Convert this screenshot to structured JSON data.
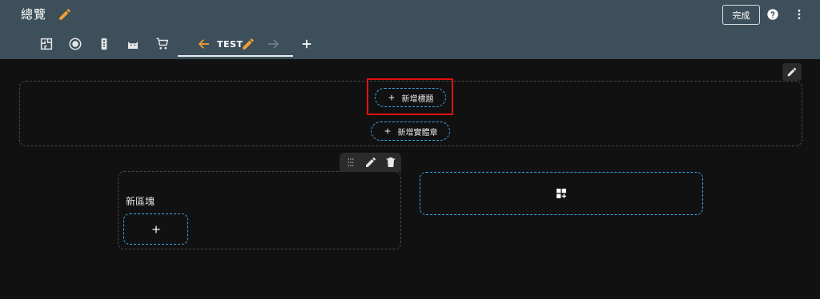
{
  "header": {
    "title": "總覽",
    "done_label": "完成",
    "icons": [
      "pencil-icon",
      "help-icon",
      "more-vert-icon"
    ]
  },
  "tabs": {
    "icons": [
      "floorplan-icon",
      "robot-vacuum-icon",
      "remote-icon",
      "cat-icon",
      "cart-icon"
    ],
    "active": {
      "label": "TEST",
      "icons": [
        "arrow-left-icon",
        "pencil-icon",
        "arrow-right-icon"
      ]
    },
    "add_icon": "plus-icon"
  },
  "section": {
    "add_heading_label": "新增標題",
    "add_entity_chip_label": "新增實體章"
  },
  "card": {
    "title": "新區塊"
  },
  "colors": {
    "header_bg": "#3d4f5b",
    "canvas_bg": "#111111",
    "accent_orange": "#f0a032",
    "dashed_blue": "#3aa8e8",
    "highlight_red": "#e01010"
  }
}
